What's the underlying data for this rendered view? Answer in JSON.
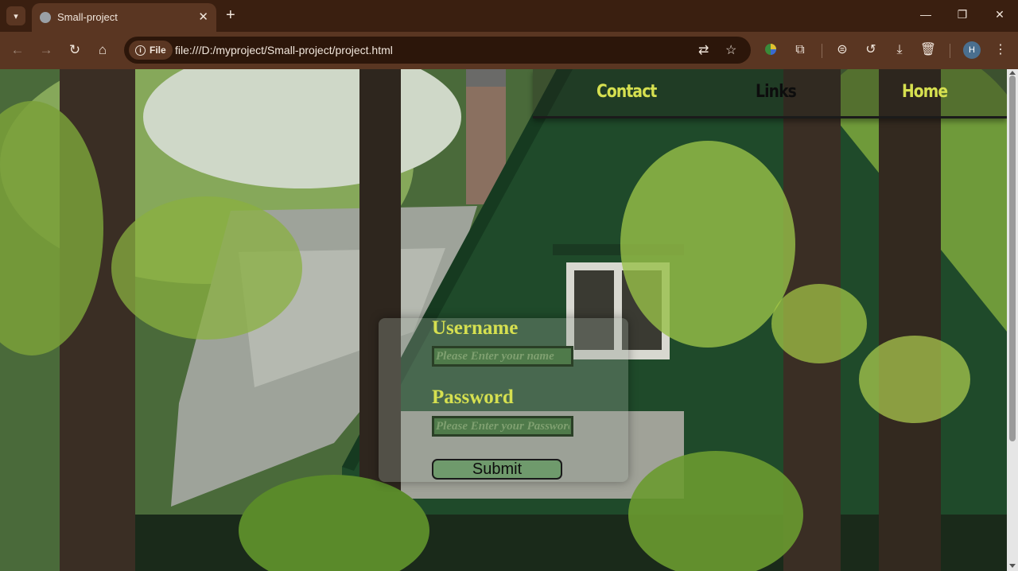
{
  "browser": {
    "tab": {
      "title": "Small-project"
    },
    "omnibox": {
      "site_chip": "File",
      "url": "file:///D:/myproject/Small-project/project.html"
    },
    "profile_initial": "H",
    "icons": {
      "tab_menu": "chevron-down-icon",
      "tab_favicon": "globe-icon",
      "tab_close": "close-icon",
      "new_tab": "plus-icon",
      "minimize": "minimize-icon",
      "restore": "restore-icon",
      "close_window": "close-icon",
      "back": "arrow-left-icon",
      "forward": "arrow-right-icon",
      "reload": "reload-icon",
      "home": "home-icon",
      "translate": "translate-icon",
      "bookmark": "star-icon",
      "extension_color": "color-extension-icon",
      "extensions": "puzzle-icon",
      "incognito": "incognito-icon",
      "history": "history-icon",
      "downloads": "download-icon",
      "delete": "trash-icon",
      "menu": "kebab-menu-icon"
    }
  },
  "page": {
    "nav": {
      "contact": "Contact",
      "links": "Links",
      "home": "Home"
    },
    "form": {
      "username_label": "Username",
      "username_placeholder": "Please Enter your name",
      "password_label": "Password",
      "password_placeholder": "Please Enter your Password",
      "submit_label": "Submit"
    },
    "colors": {
      "accent": "#d6e050",
      "nav_dark": "#0d0d0d",
      "input_bg": "#4f7a4a",
      "button_bg": "#6f9a6c"
    }
  }
}
